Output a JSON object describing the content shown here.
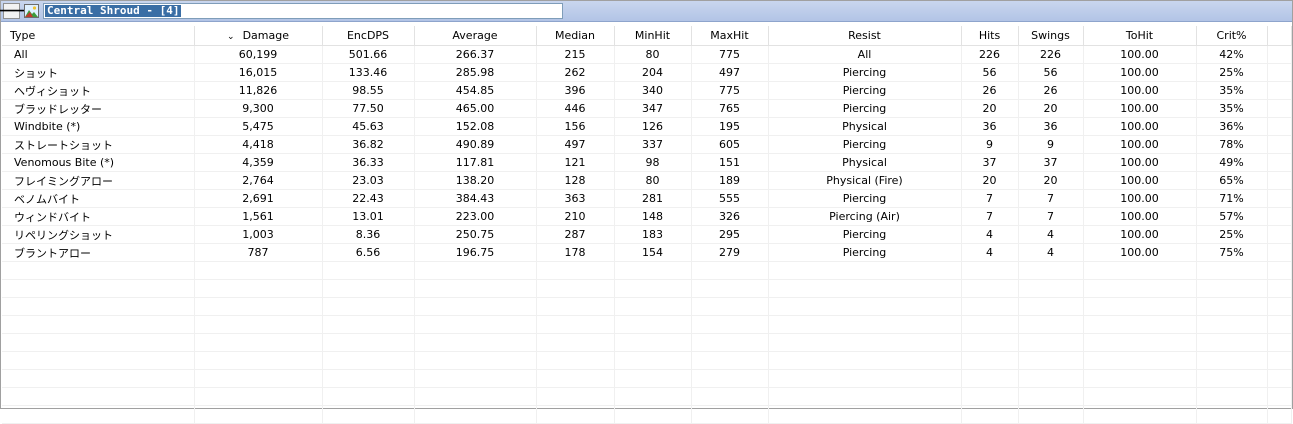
{
  "window": {
    "title": "Central Shroud - [4]"
  },
  "icons": {
    "back": "arrow-left-icon",
    "image": "image-icon"
  },
  "table": {
    "sort_indicator": "⌄",
    "columns": [
      "Type",
      "Damage",
      "EncDPS",
      "Average",
      "Median",
      "MinHit",
      "MaxHit",
      "Resist",
      "Hits",
      "Swings",
      "ToHit",
      "Crit%"
    ],
    "rows": [
      [
        "All",
        "60,199",
        "501.66",
        "266.37",
        "215",
        "80",
        "775",
        "All",
        "226",
        "226",
        "100.00",
        "42%"
      ],
      [
        "ショット",
        "16,015",
        "133.46",
        "285.98",
        "262",
        "204",
        "497",
        "Piercing",
        "56",
        "56",
        "100.00",
        "25%"
      ],
      [
        "ヘヴィショット",
        "11,826",
        "98.55",
        "454.85",
        "396",
        "340",
        "775",
        "Piercing",
        "26",
        "26",
        "100.00",
        "35%"
      ],
      [
        "ブラッドレッター",
        "9,300",
        "77.50",
        "465.00",
        "446",
        "347",
        "765",
        "Piercing",
        "20",
        "20",
        "100.00",
        "35%"
      ],
      [
        "Windbite (*)",
        "5,475",
        "45.63",
        "152.08",
        "156",
        "126",
        "195",
        "Physical",
        "36",
        "36",
        "100.00",
        "36%"
      ],
      [
        "ストレートショット",
        "4,418",
        "36.82",
        "490.89",
        "497",
        "337",
        "605",
        "Piercing",
        "9",
        "9",
        "100.00",
        "78%"
      ],
      [
        "Venomous Bite (*)",
        "4,359",
        "36.33",
        "117.81",
        "121",
        "98",
        "151",
        "Physical",
        "37",
        "37",
        "100.00",
        "49%"
      ],
      [
        "フレイミングアロー",
        "2,764",
        "23.03",
        "138.20",
        "128",
        "80",
        "189",
        "Physical (Fire)",
        "20",
        "20",
        "100.00",
        "65%"
      ],
      [
        "ベノムバイト",
        "2,691",
        "22.43",
        "384.43",
        "363",
        "281",
        "555",
        "Piercing",
        "7",
        "7",
        "100.00",
        "71%"
      ],
      [
        "ウィンドバイト",
        "1,561",
        "13.01",
        "223.00",
        "210",
        "148",
        "326",
        "Piercing (Air)",
        "7",
        "7",
        "100.00",
        "57%"
      ],
      [
        "リペリングショット",
        "1,003",
        "8.36",
        "250.75",
        "287",
        "183",
        "295",
        "Piercing",
        "4",
        "4",
        "100.00",
        "25%"
      ],
      [
        "ブラントアロー",
        "787",
        "6.56",
        "196.75",
        "178",
        "154",
        "279",
        "Piercing",
        "4",
        "4",
        "100.00",
        "75%"
      ]
    ],
    "empty_row_count": 9
  }
}
